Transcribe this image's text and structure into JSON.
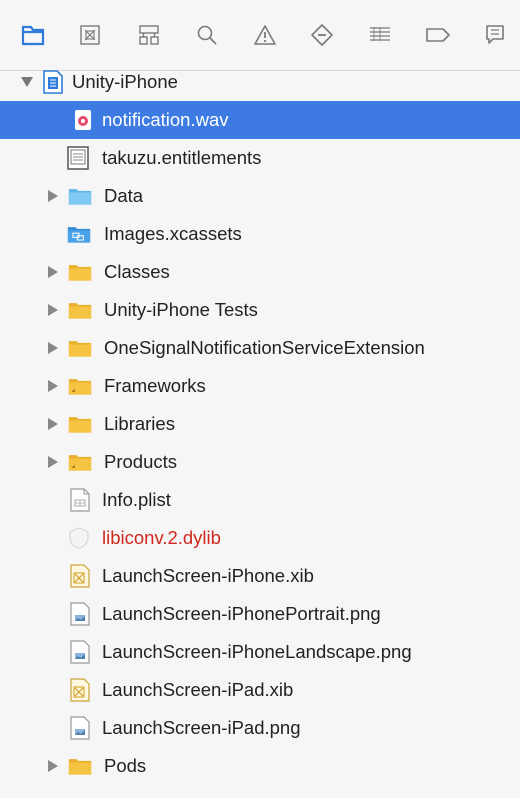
{
  "toolbar": {
    "icons": [
      "folder-icon",
      "source-control-icon",
      "symbol-icon",
      "search-icon",
      "issue-warning-icon",
      "test-diamond-icon",
      "debug-list-icon",
      "breakpoint-icon",
      "report-icon"
    ],
    "active_color": "#2f7bdc",
    "inactive_color": "#7a7a7a"
  },
  "tree": {
    "root": "Unity-iPhone",
    "items": [
      {
        "label": "notification.wav",
        "selected": true
      },
      {
        "label": "takuzu.entitlements"
      },
      {
        "label": "Data"
      },
      {
        "label": "Images.xcassets"
      },
      {
        "label": "Classes"
      },
      {
        "label": "Unity-iPhone Tests"
      },
      {
        "label": "OneSignalNotificationServiceExtension"
      },
      {
        "label": "Frameworks"
      },
      {
        "label": "Libraries"
      },
      {
        "label": "Products"
      },
      {
        "label": "Info.plist"
      },
      {
        "label": "libiconv.2.dylib",
        "missing": true
      },
      {
        "label": "LaunchScreen-iPhone.xib"
      },
      {
        "label": "LaunchScreen-iPhonePortrait.png"
      },
      {
        "label": "LaunchScreen-iPhoneLandscape.png"
      },
      {
        "label": "LaunchScreen-iPad.xib"
      },
      {
        "label": "LaunchScreen-iPad.png"
      },
      {
        "label": "Pods"
      }
    ]
  },
  "colors": {
    "selection": "#3d7be3",
    "folder": "#f6c342",
    "blue_folder": "#5fb6ea",
    "missing_text": "#d0281e"
  }
}
